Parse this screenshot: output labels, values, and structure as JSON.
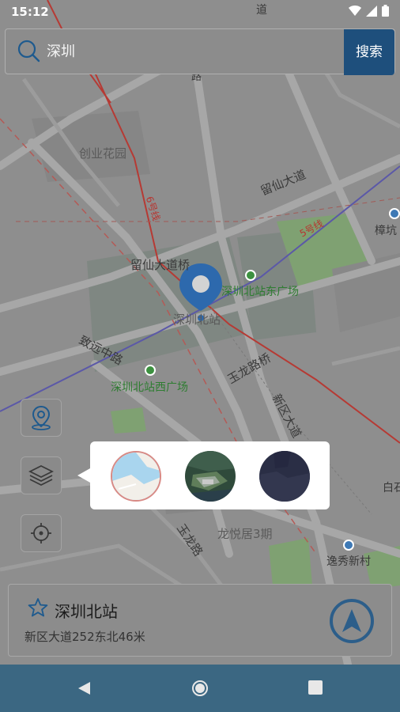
{
  "status_bar": {
    "time": "15:12"
  },
  "search": {
    "value": "深圳",
    "button_label": "搜索"
  },
  "map_labels": {
    "chuangye": "创业花园",
    "liuxian_road": "留仙大道",
    "liuxian_bridge": "留仙大道桥",
    "east_square": "深圳北站东广场",
    "station": "深圳北站",
    "zhiyuan": "致远中路",
    "west_square": "深圳北站西广场",
    "yulong": "玉龙路桥",
    "xinqu": "新区大道",
    "longyueju": "龙悦居3期",
    "yixiu": "逸秀新村",
    "zhangkeng": "樟坑",
    "baishi": "白石",
    "line6": "6号线",
    "line5": "5号线",
    "yulong_road": "玉龙路",
    "road_top": "道",
    "road_top2": "路"
  },
  "info_card": {
    "title": "深圳北站",
    "address": "新区大道252东北46米"
  },
  "colors": {
    "accent": "#1e4f7c",
    "nav_bar": "#3b6782"
  }
}
